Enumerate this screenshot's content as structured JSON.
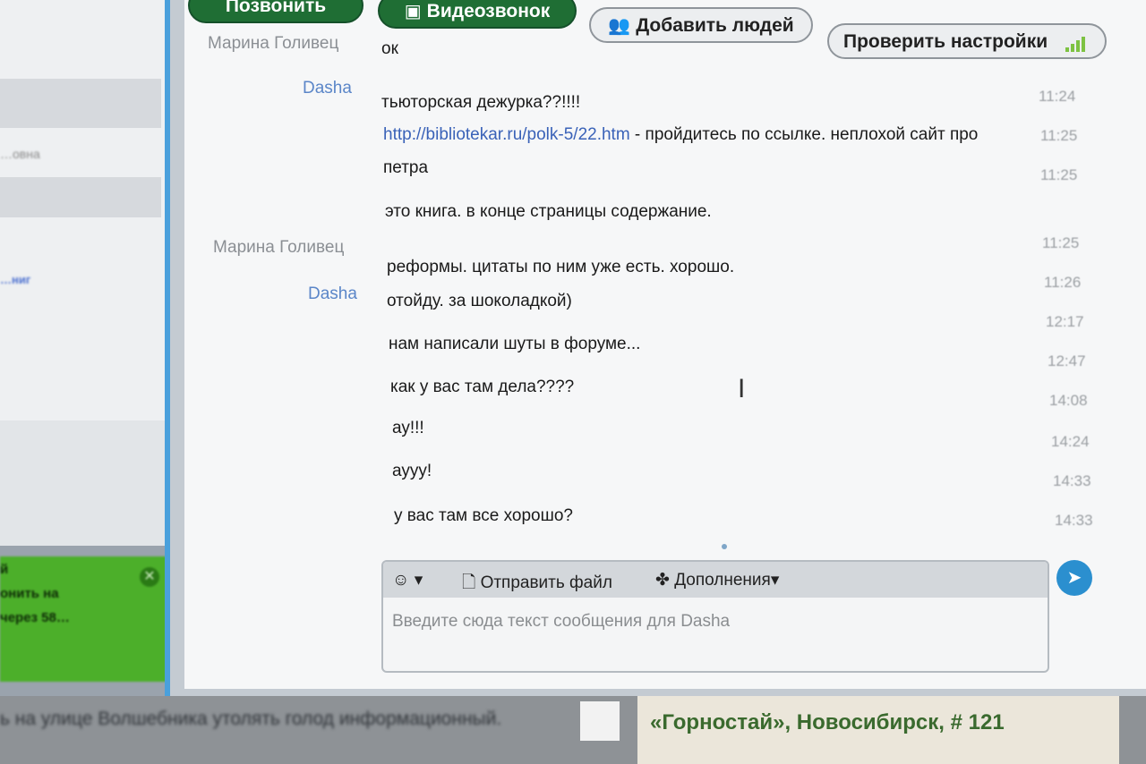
{
  "toolbar": {
    "call_label": "Позвонить",
    "video_label": "Видеозвонок",
    "add_people_label": "Добавить людей",
    "check_settings_label": "Проверить настройки"
  },
  "contacts": {
    "row2_text": "…овна",
    "row4_text": "…ниг"
  },
  "notification": {
    "line1": "й",
    "line2": "онить на",
    "line3": "через 58…"
  },
  "messages": [
    {
      "sender": "Марина Голивец",
      "text": "ок",
      "time": ""
    },
    {
      "sender": "Dasha",
      "text": "тьюторская дежурка??!!!!",
      "time": "11:24"
    },
    {
      "sender": "",
      "link": "http://bibliotekar.ru/polk-5/22.htm",
      "text": " - пройдитесь по ссылке. неплохой сайт про",
      "time": "11:25"
    },
    {
      "sender": "",
      "text": "петра",
      "time": "11:25"
    },
    {
      "sender": "",
      "text": "это книга. в конце страницы содержание.",
      "time": ""
    },
    {
      "sender": "Марина Голивец",
      "text": "реформы. цитаты по ним уже есть. хорошо.",
      "time": "11:25"
    },
    {
      "sender": "Dasha",
      "text": "отойду. за шоколадкой)",
      "time": "11:26"
    },
    {
      "sender": "",
      "text": "нам написали шуты в форуме...",
      "time": "12:17"
    },
    {
      "sender": "",
      "text": "как у вас там дела????",
      "time": "12:47"
    },
    {
      "sender": "",
      "text": "ау!!!",
      "time": "14:08"
    },
    {
      "sender": "",
      "text": "аууу!",
      "time": "14:24"
    },
    {
      "sender": "",
      "text": "у вас там все хорошо?",
      "time": "14:33"
    },
    {
      "sender": "",
      "text": "",
      "time": "14:33"
    }
  ],
  "input": {
    "send_file_label": "Отправить файл",
    "addons_label": "Дополнения",
    "placeholder": "Введите сюда текст сообщения для Dasha"
  },
  "background_page": {
    "left_text": "ь на улице Волшебника утолять голод информационный.",
    "right_title": "«Горностай», Новосибирск, # 121"
  },
  "icons": {
    "add_people": "people-icon",
    "settings_signal": "signal-bars-icon",
    "emoji": "smiley-icon",
    "file": "file-icon",
    "addons": "puzzle-icon",
    "send": "send-icon",
    "close": "close-icon"
  },
  "colors": {
    "accent_blue": "#4aa0dc",
    "call_green": "#1f6e34",
    "notification_green": "#4caf2a",
    "sender_blue": "#5b86c8",
    "link_blue": "#3a62b8"
  }
}
